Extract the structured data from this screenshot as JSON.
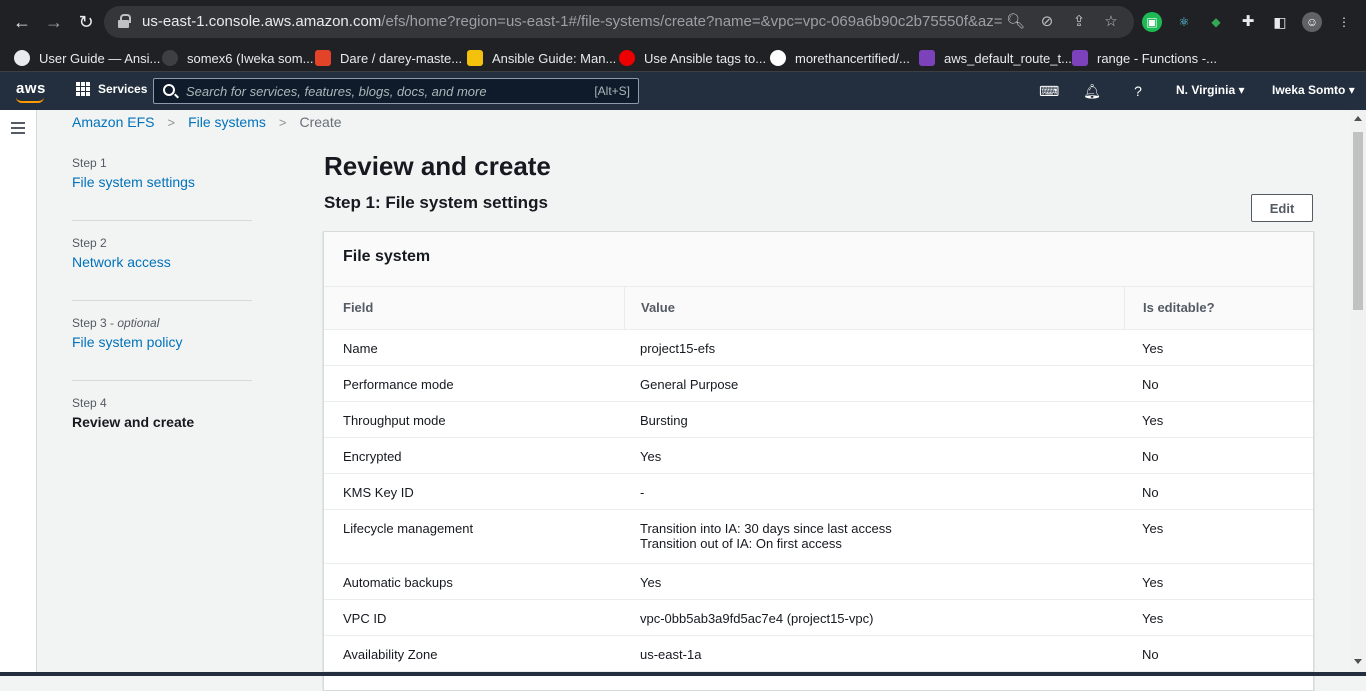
{
  "browser": {
    "url_host": "us-east-1.console.aws.amazon.com",
    "url_path": "/efs/home?region=us-east-1#/file-systems/create?name=&vpc=vpc-069a6b90c2b75550f&az=us-eas..."
  },
  "bookmarks": [
    {
      "label": "User Guide — Ansi...",
      "icon": "globe-icon",
      "color": "#e8eaed"
    },
    {
      "label": "somex6 (Iweka som...",
      "icon": "github-icon",
      "color": "#3c4043"
    },
    {
      "label": "Dare / darey-maste...",
      "icon": "gitlab-icon",
      "color": "#e24329"
    },
    {
      "label": "Ansible Guide: Man...",
      "icon": "bulb-icon",
      "color": "#f4c20d"
    },
    {
      "label": "Use Ansible tags to...",
      "icon": "redhat-icon",
      "color": "#ee0000"
    },
    {
      "label": "morethancertified/...",
      "icon": "github-icon",
      "color": "#ffffff"
    },
    {
      "label": "aws_default_route_t...",
      "icon": "terraform-icon",
      "color": "#7b42bc"
    },
    {
      "label": "range - Functions -...",
      "icon": "terraform-icon",
      "color": "#7b42bc"
    }
  ],
  "aws_nav": {
    "logo": "aws",
    "services_label": "Services",
    "search_placeholder": "Search for services, features, blogs, docs, and more",
    "search_shortcut": "[Alt+S]",
    "region": "N. Virginia ▾",
    "user": "Iweka Somto ▾"
  },
  "breadcrumb": {
    "items": [
      "Amazon EFS",
      "File systems"
    ],
    "current": "Create"
  },
  "steps": [
    {
      "num": "Step 1",
      "optional": "",
      "title": "File system settings",
      "active": false
    },
    {
      "num": "Step 2",
      "optional": "",
      "title": "Network access",
      "active": false
    },
    {
      "num": "Step 3 - ",
      "optional": "optional",
      "title": "File system policy",
      "active": false
    },
    {
      "num": "Step 4",
      "optional": "",
      "title": "Review and create",
      "active": true
    }
  ],
  "page": {
    "title": "Review and create",
    "section_title": "Step 1: File system settings",
    "edit_label": "Edit"
  },
  "panel": {
    "header": "File system",
    "columns": [
      "Field",
      "Value",
      "Is editable?"
    ],
    "rows": [
      {
        "field": "Name",
        "value": [
          "project15-efs"
        ],
        "editable": "Yes"
      },
      {
        "field": "Performance mode",
        "value": [
          "General Purpose"
        ],
        "editable": "No"
      },
      {
        "field": "Throughput mode",
        "value": [
          "Bursting"
        ],
        "editable": "Yes"
      },
      {
        "field": "Encrypted",
        "value": [
          "Yes"
        ],
        "editable": "No"
      },
      {
        "field": "KMS Key ID",
        "value": [
          "-"
        ],
        "editable": "No"
      },
      {
        "field": "Lifecycle management",
        "value": [
          "Transition into IA: 30 days since last access",
          "Transition out of IA: On first access"
        ],
        "editable": "Yes"
      },
      {
        "field": "Automatic backups",
        "value": [
          "Yes"
        ],
        "editable": "Yes"
      },
      {
        "field": "VPC ID",
        "value": [
          "vpc-0bb5ab3a9fd5ac7e4 (project15-vpc)"
        ],
        "editable": "Yes"
      },
      {
        "field": "Availability Zone",
        "value": [
          "us-east-1a"
        ],
        "editable": "No"
      }
    ]
  }
}
